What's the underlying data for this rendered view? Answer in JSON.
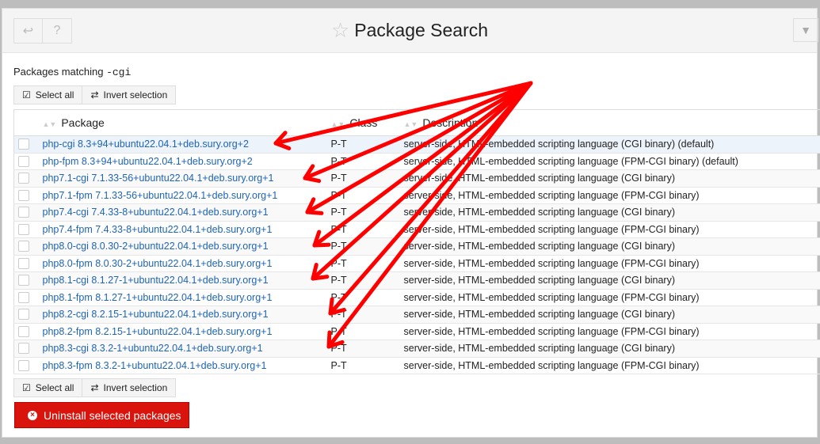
{
  "header": {
    "title": "Package Search",
    "back_icon": "back-arrow-icon",
    "help_icon": "help-icon",
    "star_icon": "star-icon",
    "filter_icon": "filter-icon"
  },
  "matching": {
    "label": "Packages matching",
    "term": "-cgi"
  },
  "selection": {
    "select_all": "Select all",
    "invert": "Invert selection"
  },
  "table": {
    "columns": [
      "Package",
      "Class",
      "Description"
    ],
    "rows": [
      {
        "package": "php-cgi 8.3+94+ubuntu22.04.1+deb.sury.org+2",
        "class": "P-T",
        "description": "server-side, HTML-embedded scripting language (CGI binary) (default)"
      },
      {
        "package": "php-fpm 8.3+94+ubuntu22.04.1+deb.sury.org+2",
        "class": "P-T",
        "description": "server-side, HTML-embedded scripting language (FPM-CGI binary) (default)"
      },
      {
        "package": "php7.1-cgi 7.1.33-56+ubuntu22.04.1+deb.sury.org+1",
        "class": "P-T",
        "description": "server-side, HTML-embedded scripting language (CGI binary)"
      },
      {
        "package": "php7.1-fpm 7.1.33-56+ubuntu22.04.1+deb.sury.org+1",
        "class": "P-T",
        "description": "server-side, HTML-embedded scripting language (FPM-CGI binary)"
      },
      {
        "package": "php7.4-cgi 7.4.33-8+ubuntu22.04.1+deb.sury.org+1",
        "class": "P-T",
        "description": "server-side, HTML-embedded scripting language (CGI binary)"
      },
      {
        "package": "php7.4-fpm 7.4.33-8+ubuntu22.04.1+deb.sury.org+1",
        "class": "P-T",
        "description": "server-side, HTML-embedded scripting language (FPM-CGI binary)"
      },
      {
        "package": "php8.0-cgi 8.0.30-2+ubuntu22.04.1+deb.sury.org+1",
        "class": "P-T",
        "description": "server-side, HTML-embedded scripting language (CGI binary)"
      },
      {
        "package": "php8.0-fpm 8.0.30-2+ubuntu22.04.1+deb.sury.org+1",
        "class": "P-T",
        "description": "server-side, HTML-embedded scripting language (FPM-CGI binary)"
      },
      {
        "package": "php8.1-cgi 8.1.27-1+ubuntu22.04.1+deb.sury.org+1",
        "class": "P-T",
        "description": "server-side, HTML-embedded scripting language (CGI binary)"
      },
      {
        "package": "php8.1-fpm 8.1.27-1+ubuntu22.04.1+deb.sury.org+1",
        "class": "P-T",
        "description": "server-side, HTML-embedded scripting language (FPM-CGI binary)"
      },
      {
        "package": "php8.2-cgi 8.2.15-1+ubuntu22.04.1+deb.sury.org+1",
        "class": "P-T",
        "description": "server-side, HTML-embedded scripting language (CGI binary)"
      },
      {
        "package": "php8.2-fpm 8.2.15-1+ubuntu22.04.1+deb.sury.org+1",
        "class": "P-T",
        "description": "server-side, HTML-embedded scripting language (FPM-CGI binary)"
      },
      {
        "package": "php8.3-cgi 8.3.2-1+ubuntu22.04.1+deb.sury.org+1",
        "class": "P-T",
        "description": "server-side, HTML-embedded scripting language (CGI binary)"
      },
      {
        "package": "php8.3-fpm 8.3.2-1+ubuntu22.04.1+deb.sury.org+1",
        "class": "P-T",
        "description": "server-side, HTML-embedded scripting language (FPM-CGI binary)"
      }
    ]
  },
  "uninstall_label": "Uninstall selected packages",
  "colors": {
    "accent_red": "#d9140c",
    "link": "#1e64b4",
    "annotation": "#ff0000"
  }
}
